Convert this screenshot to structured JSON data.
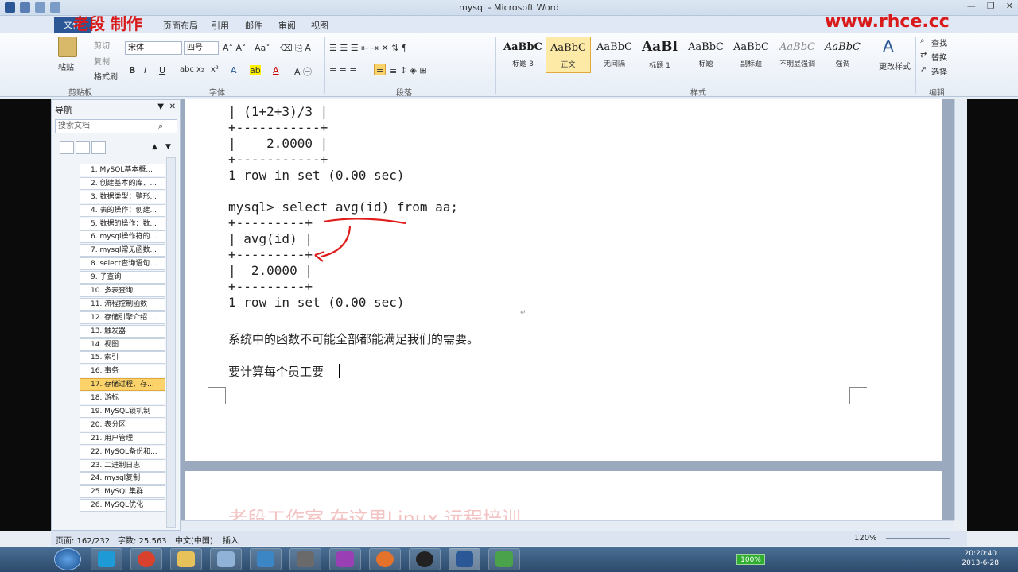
{
  "window": {
    "title": "mysql - Microsoft Word"
  },
  "watermark": {
    "left": "老段 制作",
    "right": "www.rhce.cc"
  },
  "tabs": {
    "file": "文件",
    "items": [
      "页面布局",
      "引用",
      "邮件",
      "审阅",
      "视图"
    ]
  },
  "ribbon": {
    "clipboard": {
      "paste": "粘贴",
      "cut": "剪切",
      "copy": "复制",
      "format_painter": "格式刷",
      "label": "剪贴板"
    },
    "font": {
      "name": "宋体",
      "size": "四号",
      "label": "字体"
    },
    "paragraph": {
      "label": "段落"
    },
    "styles": {
      "label": "样式",
      "items": [
        {
          "sample": "AaBbC",
          "name": "标题 3"
        },
        {
          "sample": "AaBbC",
          "name": "正文"
        },
        {
          "sample": "AaBbC",
          "name": "无间隔"
        },
        {
          "sample": "AaBl",
          "name": "标题 1"
        },
        {
          "sample": "AaBbC",
          "name": "标题"
        },
        {
          "sample": "AaBbC",
          "name": "副标题"
        },
        {
          "sample": "AaBbC",
          "name": "不明显强调"
        },
        {
          "sample": "AaBbC",
          "name": "强调"
        }
      ],
      "change": "更改样式"
    },
    "editing": {
      "find": "查找",
      "replace": "替换",
      "select": "选择",
      "label": "编辑"
    }
  },
  "nav": {
    "title": "导航",
    "search_placeholder": "搜索文档",
    "items": [
      "1. MySQL基本概...",
      "2. 创建基本的库、...",
      "3. 数据类型：整形...",
      "4. 表的操作：创建...",
      "5. 数据的操作：数...",
      "6. mysql操作符的...",
      "7. mysql常见函数...",
      "8. select查询语句...",
      "9. 子查询",
      "10. 多表查询",
      "11. 流程控制函数",
      "12. 存储引擎介绍 ...",
      "13. 触发器",
      "14. 视图",
      "15. 索引",
      "16. 事务",
      "17. 存储过程、存...",
      "18. 游标",
      "19. MySQL锁机制",
      "20. 表分区",
      "21. 用户管理",
      "22. MySQL备份和...",
      "23. 二进制日志",
      "24. mysql复制",
      "25. MySQL集群",
      "26. MySQL优化"
    ]
  },
  "doc": {
    "lines": [
      "| (1+2+3)/3 |",
      "+-----------+",
      "|    2.0000 |",
      "+-----------+",
      "1 row in set (0.00 sec)",
      "mysql> select avg(id) from aa;",
      "+---------+",
      "| avg(id) |",
      "+---------+",
      "|  2.0000 |",
      "+---------+",
      "1 row in set (0.00 sec)"
    ],
    "para1": "系统中的函数不可能全部都能满足我们的需要。",
    "para2": "要计算每个员工要",
    "page2_text": "老段工作室  在这里Linux 远程培训"
  },
  "status": {
    "page": "页面: 162/232",
    "words": "字数: 25,563",
    "lang": "中文(中国)",
    "mode": "插入",
    "zoom": "120%"
  },
  "taskbar": {
    "time": "20:20:40",
    "date": "2013-6-28",
    "battery": "100%"
  }
}
